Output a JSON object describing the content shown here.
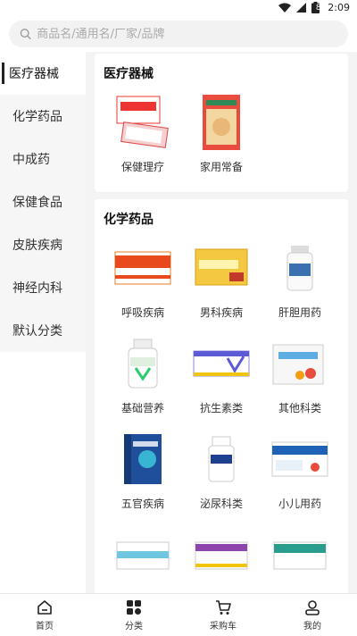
{
  "status": {
    "time": "2:09",
    "battery": "8"
  },
  "search": {
    "placeholder": "商品名/通用名/厂家/品牌"
  },
  "sidebar": {
    "items": [
      {
        "label": "医疗器械",
        "active": true
      },
      {
        "label": "化学药品"
      },
      {
        "label": "中成药"
      },
      {
        "label": "保健食品"
      },
      {
        "label": "皮肤疾病"
      },
      {
        "label": "神经内科"
      },
      {
        "label": "默认分类"
      }
    ]
  },
  "sections": [
    {
      "title": "医疗器械",
      "items": [
        {
          "label": "保健理疗"
        },
        {
          "label": "家用常备"
        }
      ]
    },
    {
      "title": "化学药品",
      "items": [
        {
          "label": "呼吸疾病"
        },
        {
          "label": "男科疾病"
        },
        {
          "label": "肝胆用药"
        },
        {
          "label": "基础营养"
        },
        {
          "label": "抗生素类"
        },
        {
          "label": "其他科类"
        },
        {
          "label": "五官疾病"
        },
        {
          "label": "泌尿科类"
        },
        {
          "label": "小儿用药"
        }
      ]
    }
  ],
  "tabbar": {
    "items": [
      {
        "label": "首页",
        "icon": "home-icon"
      },
      {
        "label": "分类",
        "icon": "category-icon"
      },
      {
        "label": "采购车",
        "icon": "cart-icon"
      },
      {
        "label": "我的",
        "icon": "user-icon"
      }
    ]
  }
}
